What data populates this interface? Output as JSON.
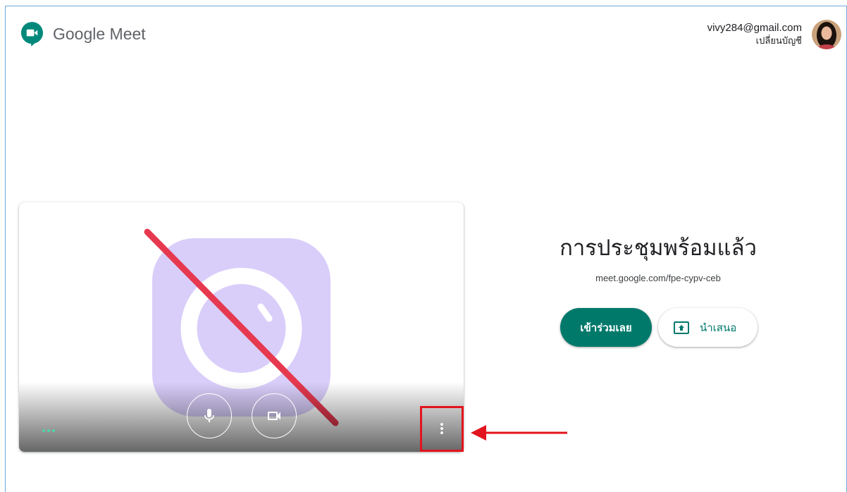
{
  "app": {
    "name": "Google Meet",
    "logo_icon": "google-meet-logo-icon"
  },
  "account": {
    "email": "vivy284@gmail.com",
    "switch_account_label": "เปลี่ยนบัญชี",
    "avatar_icon": "user-avatar-photo"
  },
  "preview": {
    "camera_state_icon": "camera-off-illustration",
    "audio_level_icon": "audio-level-dots-icon",
    "microphone_icon": "microphone-icon",
    "camera_icon": "video-camera-icon",
    "more_options_icon": "more-vert-icon"
  },
  "meeting": {
    "heading": "การประชุมพร้อมแล้ว",
    "link": "meet.google.com/fpe-cypv-ceb",
    "join_label": "เข้าร่วมเลย",
    "present_label": "นำเสนอ",
    "present_icon": "present-to-all-icon"
  },
  "annotation": {
    "highlight_icon": "highlight-box",
    "arrow_icon": "arrow-left-icon"
  },
  "colors": {
    "accent": "#00796b",
    "logo_green": "#00897b",
    "illustration_lavender": "#d9cefa",
    "camera_off_slash": "#e63950",
    "audio_level": "#4dd6a5",
    "annotation_red": "#e2141d",
    "window_border": "#6fa8dc"
  }
}
